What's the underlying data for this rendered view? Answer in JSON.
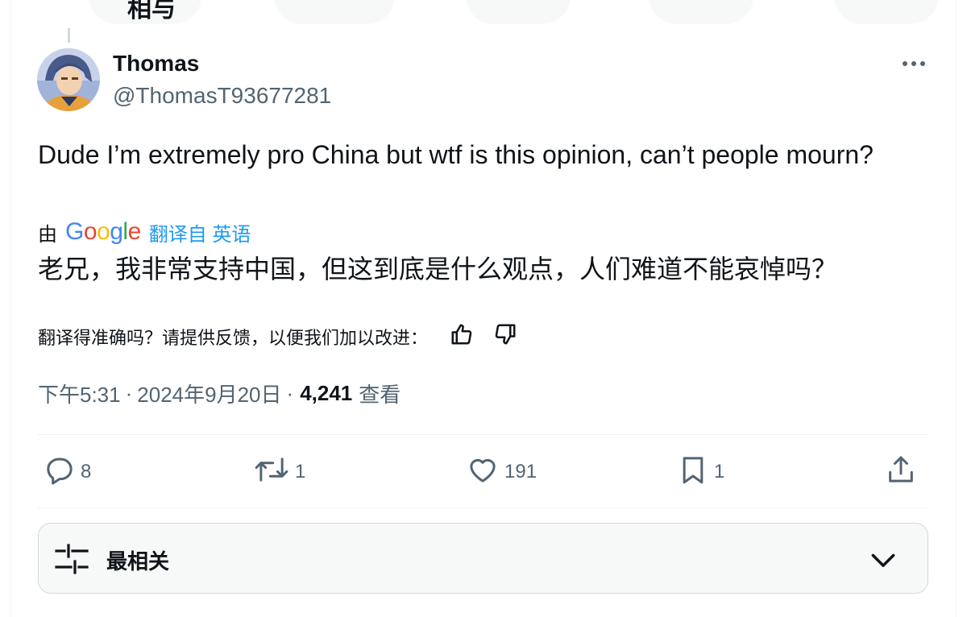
{
  "header": {
    "fragment": "相与"
  },
  "tweet": {
    "author_name": "Thomas",
    "author_handle": "@ThomasT93677281",
    "text": "Dude I’m extremely pro China but wtf is this opinion, can’t people mourn?",
    "translation": {
      "by_label": "由",
      "provider": "Google",
      "translated_from": "翻译自 英语",
      "text": "老兄，我非常支持中国，但这到底是什么观点，人们难道不能哀悼吗？",
      "feedback_prompt": "翻译得准确吗？请提供反馈，以便我们加以改进："
    },
    "time": "下午5:31",
    "date": "2024年9月20日",
    "separator": "·",
    "views_count": "4,241",
    "views_label": "查看"
  },
  "actions": {
    "reply_count": "8",
    "retweet_count": "1",
    "like_count": "191",
    "bookmark_count": "1"
  },
  "sort": {
    "label": "最相关"
  },
  "colors": {
    "accent": "#1d9bf0",
    "text": "#0f1419",
    "secondary": "#536471",
    "border": "#eff3f4"
  },
  "icons": [
    "more-icon",
    "thumbs-up-icon",
    "thumbs-down-icon",
    "reply-icon",
    "retweet-icon",
    "like-icon",
    "bookmark-icon",
    "share-icon",
    "sort-sliders-icon",
    "chevron-down-icon"
  ]
}
